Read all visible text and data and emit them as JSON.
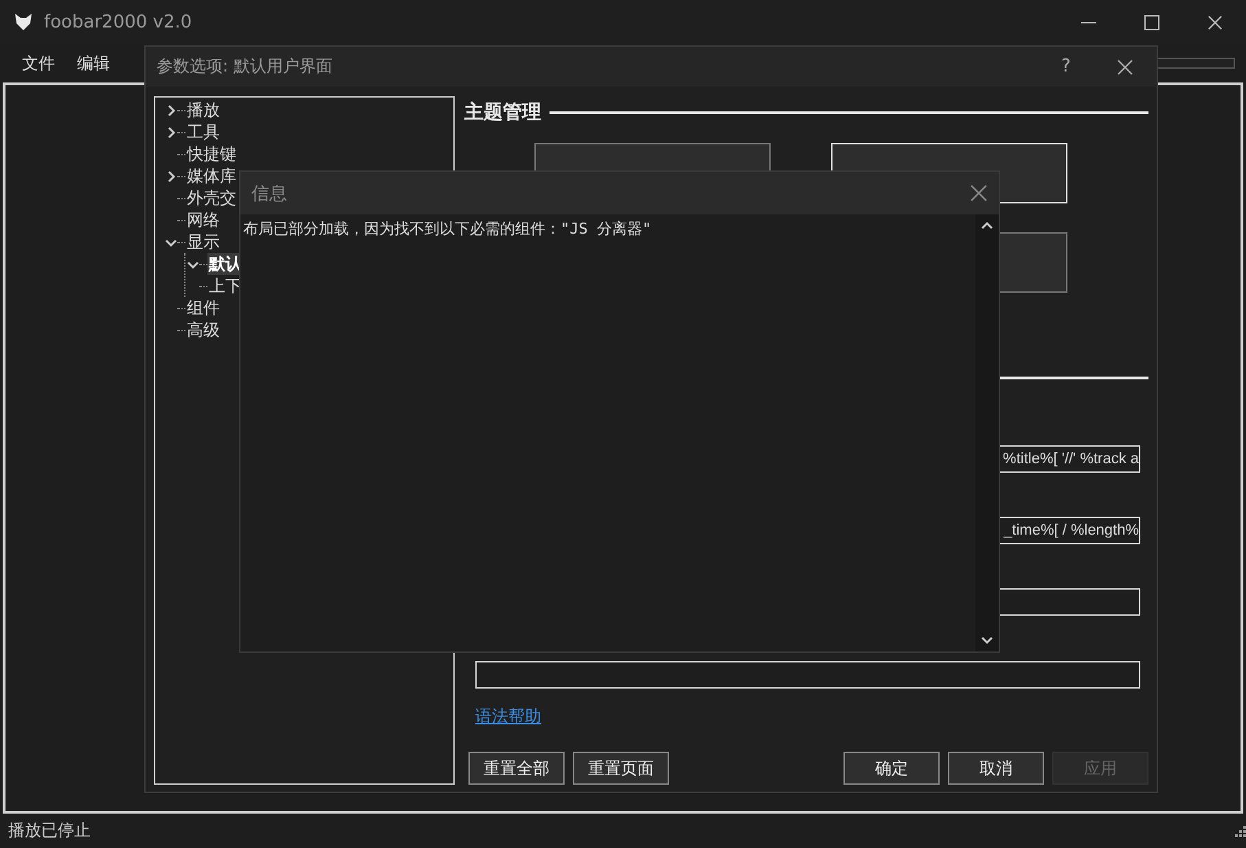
{
  "main_window": {
    "title": "foobar2000 v2.0",
    "menu": [
      "文件",
      "编辑"
    ],
    "status_bar": "播放已停止"
  },
  "preferences": {
    "title": "参数选项: 默认用户界面",
    "help": "?",
    "tree": [
      {
        "label": "播放",
        "selected": false,
        "expanded": false
      },
      {
        "label": "工具",
        "selected": false,
        "expanded": false
      },
      {
        "label": "快捷键",
        "selected": false
      },
      {
        "label": "媒体库",
        "selected": false,
        "expanded": false
      },
      {
        "label": "外壳交",
        "selected": false
      },
      {
        "label": "网络",
        "selected": false
      },
      {
        "label": "显示",
        "selected": false,
        "expanded": true,
        "children": [
          {
            "label": "默认",
            "selected": true,
            "expanded": true
          },
          {
            "label": "上下",
            "selected": false
          }
        ]
      },
      {
        "label": "组件",
        "selected": false
      },
      {
        "label": "高级",
        "selected": false
      }
    ],
    "section_title": "主题管理",
    "fields": [
      {
        "value": "%title%[ '//' %track a"
      },
      {
        "value": "_time%[ / %length%"
      }
    ],
    "help_link": "语法帮助",
    "buttons": [
      {
        "label": "重置全部",
        "disabled": false
      },
      {
        "label": "重置页面",
        "disabled": false
      },
      {
        "label": "确定",
        "disabled": false
      },
      {
        "label": "取消",
        "disabled": false
      },
      {
        "label": "应用",
        "disabled": true
      }
    ]
  },
  "info_dialog": {
    "title": "信息",
    "message": "布局已部分加载，因为找不到以下必需的组件：\"JS 分离器\""
  }
}
